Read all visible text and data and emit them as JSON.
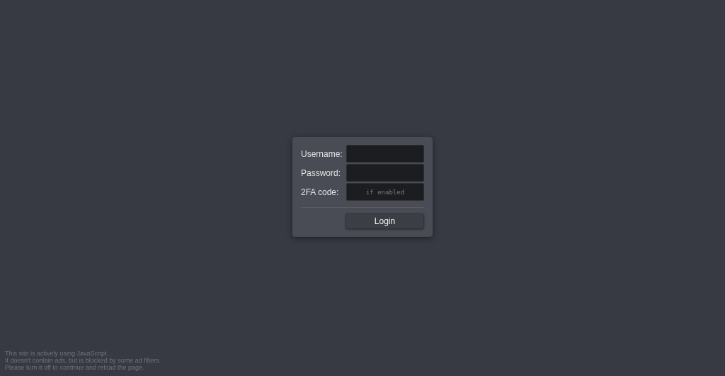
{
  "login_form": {
    "fields": [
      {
        "label": "Username:"
      },
      {
        "label": "Password:"
      },
      {
        "label": "2FA code:",
        "placeholder": "if enabled"
      }
    ],
    "button": "Login"
  },
  "notice": [
    "This site is actively using JavaScript.",
    "It doesn't contain ads, but is blocked by some ad filters.",
    "Please turn it off to continue and reload the page."
  ]
}
